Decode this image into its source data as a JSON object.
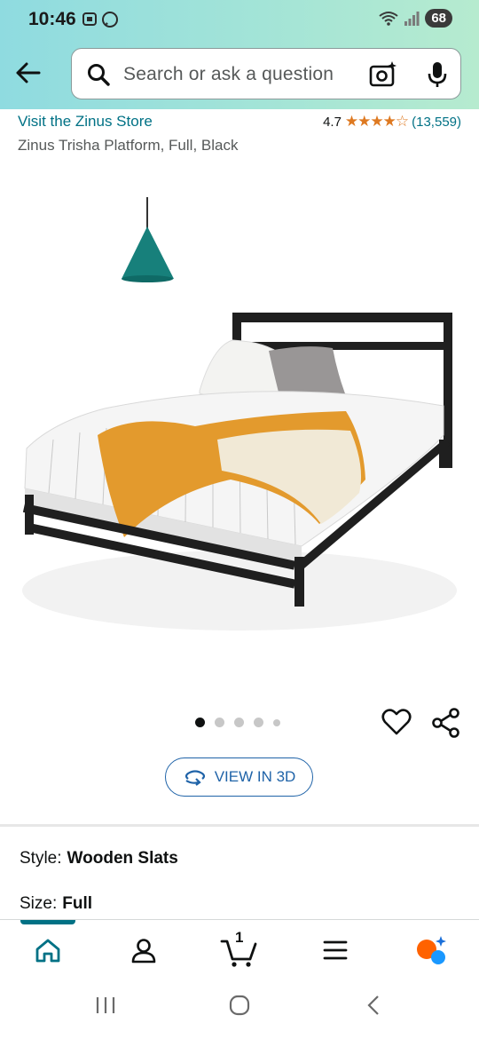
{
  "status_bar": {
    "time": "10:46",
    "battery": "68"
  },
  "search": {
    "placeholder": "Search or ask a question"
  },
  "product": {
    "store_link": "Visit the Zinus Store",
    "rating": "4.7",
    "stars": "★★★★☆",
    "review_count": "(13,559)",
    "title": "Zinus Trisha Platform, Full, Black"
  },
  "gallery": {
    "image_count": 5,
    "active_index": 0
  },
  "view_3d": {
    "label": "VIEW IN 3D"
  },
  "options": {
    "style_label": "Style:",
    "style_value": "Wooden Slats",
    "size_label": "Size:",
    "size_value": "Full"
  },
  "bottom_nav": {
    "cart_count": "1"
  },
  "colors": {
    "accent": "#007185",
    "star": "#de7921",
    "view3d_blue": "#1f63a8",
    "header_start": "#8fdbe0",
    "header_end": "#b6ebcf"
  }
}
